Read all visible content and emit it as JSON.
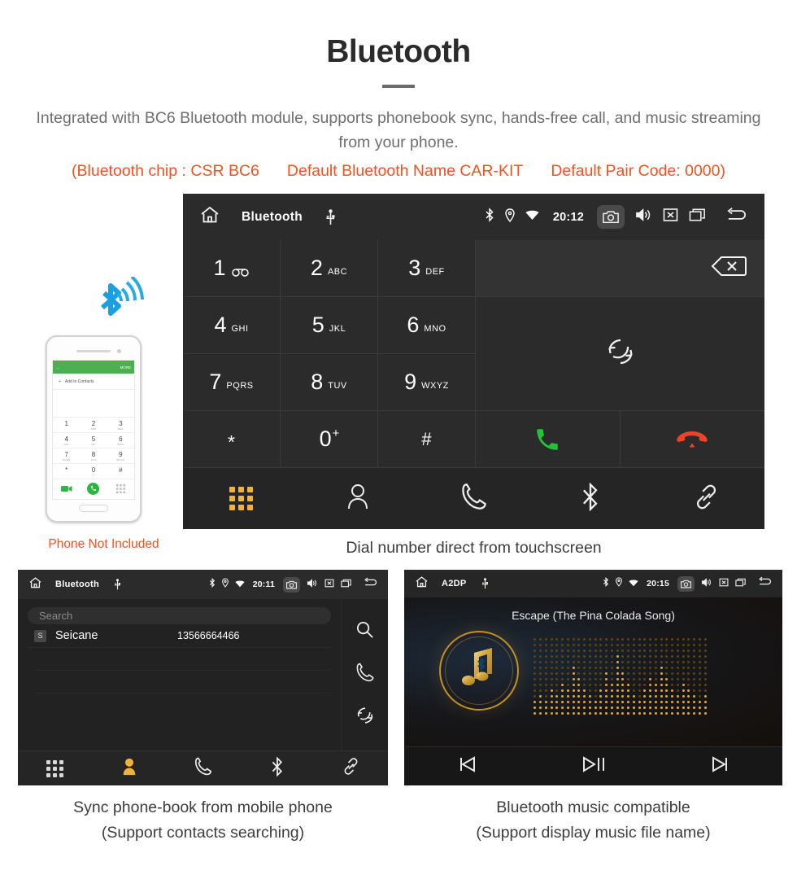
{
  "header": {
    "title": "Bluetooth",
    "description": "Integrated with BC6 Bluetooth module, supports phonebook sync, hands-free call, and music streaming from your phone.",
    "specs": [
      "(Bluetooth chip : CSR BC6",
      "Default Bluetooth Name CAR-KIT",
      "Default Pair Code: 0000)"
    ],
    "accent_color": "#f4511e"
  },
  "dial_screen": {
    "statusbar": {
      "title": "Bluetooth",
      "time": "20:12",
      "icons": [
        "home-icon",
        "usb-icon",
        "bluetooth-icon",
        "location-icon",
        "wifi-icon",
        "camera-icon",
        "volume-icon",
        "mute-icon",
        "recents-icon",
        "back-icon"
      ]
    },
    "keys": [
      {
        "digit": "1",
        "sub": "",
        "voicemail": true
      },
      {
        "digit": "2",
        "sub": "ABC"
      },
      {
        "digit": "3",
        "sub": "DEF"
      },
      {
        "digit": "4",
        "sub": "GHI"
      },
      {
        "digit": "5",
        "sub": "JKL"
      },
      {
        "digit": "6",
        "sub": "MNO"
      },
      {
        "digit": "7",
        "sub": "PQRS"
      },
      {
        "digit": "8",
        "sub": "TUV"
      },
      {
        "digit": "9",
        "sub": "WXYZ"
      },
      {
        "digit": "*",
        "sub": ""
      },
      {
        "digit": "0",
        "sub": "+"
      },
      {
        "digit": "#",
        "sub": ""
      }
    ],
    "number_input_value": "",
    "backspace_icon": "backspace-icon",
    "sync_icon": "sync-icon",
    "call_icon": "call-icon",
    "hangup_icon": "hangup-icon",
    "call_color": "#23c23a",
    "hangup_color": "#f0422a",
    "tabs": [
      {
        "name": "dialpad",
        "icon": "dialpad-icon",
        "active": true
      },
      {
        "name": "contacts",
        "icon": "contact-icon",
        "active": false
      },
      {
        "name": "call-log",
        "icon": "phone-icon",
        "active": false
      },
      {
        "name": "bluetooth",
        "icon": "bluetooth-icon",
        "active": false
      },
      {
        "name": "pair",
        "icon": "link-icon",
        "active": false
      }
    ],
    "active_color": "#f2b33d",
    "caption": "Dial number direct from touchscreen"
  },
  "phone_illustration": {
    "app_bar_more_label": "MORE",
    "add_contacts_label": "Add to Contacts",
    "keypad": [
      {
        "digit": "1",
        "sub": ""
      },
      {
        "digit": "2",
        "sub": "ABC"
      },
      {
        "digit": "3",
        "sub": "DEF"
      },
      {
        "digit": "4",
        "sub": "GHI"
      },
      {
        "digit": "5",
        "sub": "JKL"
      },
      {
        "digit": "6",
        "sub": "MNO"
      },
      {
        "digit": "7",
        "sub": "PQRS"
      },
      {
        "digit": "8",
        "sub": "TUV"
      },
      {
        "digit": "9",
        "sub": "WXYZ"
      },
      {
        "digit": "*",
        "sub": ""
      },
      {
        "digit": "0",
        "sub": "+"
      },
      {
        "digit": "#",
        "sub": ""
      }
    ],
    "note": "Phone Not Included",
    "note_color": "#f4511e",
    "bluetooth_signal_color": "#1a9fe0"
  },
  "phonebook_screen": {
    "statusbar": {
      "title": "Bluetooth",
      "time": "20:11"
    },
    "search_placeholder": "Search",
    "contacts": [
      {
        "initial": "S",
        "name": "Seicane",
        "number": "13566664466"
      }
    ],
    "side_icons": [
      "search-icon",
      "phone-icon",
      "sync-icon"
    ],
    "tabs": [
      {
        "name": "dialpad",
        "icon": "dialpad-icon",
        "active": false
      },
      {
        "name": "contacts",
        "icon": "contact-icon",
        "active": true
      },
      {
        "name": "call-log",
        "icon": "phone-icon",
        "active": false
      },
      {
        "name": "bluetooth",
        "icon": "bluetooth-icon",
        "active": false
      },
      {
        "name": "pair",
        "icon": "link-icon",
        "active": false
      }
    ],
    "caption_line1": "Sync phone-book from mobile phone",
    "caption_line2": "(Support contacts searching)"
  },
  "music_screen": {
    "statusbar": {
      "title": "A2DP",
      "time": "20:15"
    },
    "song_title": "Escape (The Pina Colada Song)",
    "album_icon": "bluetooth-music-note-icon",
    "controls": [
      "previous-icon",
      "play-pause-icon",
      "next-icon"
    ],
    "accent_color": "#e8a62c",
    "caption_line1": "Bluetooth music compatible",
    "caption_line2": "(Support display music file name)"
  }
}
